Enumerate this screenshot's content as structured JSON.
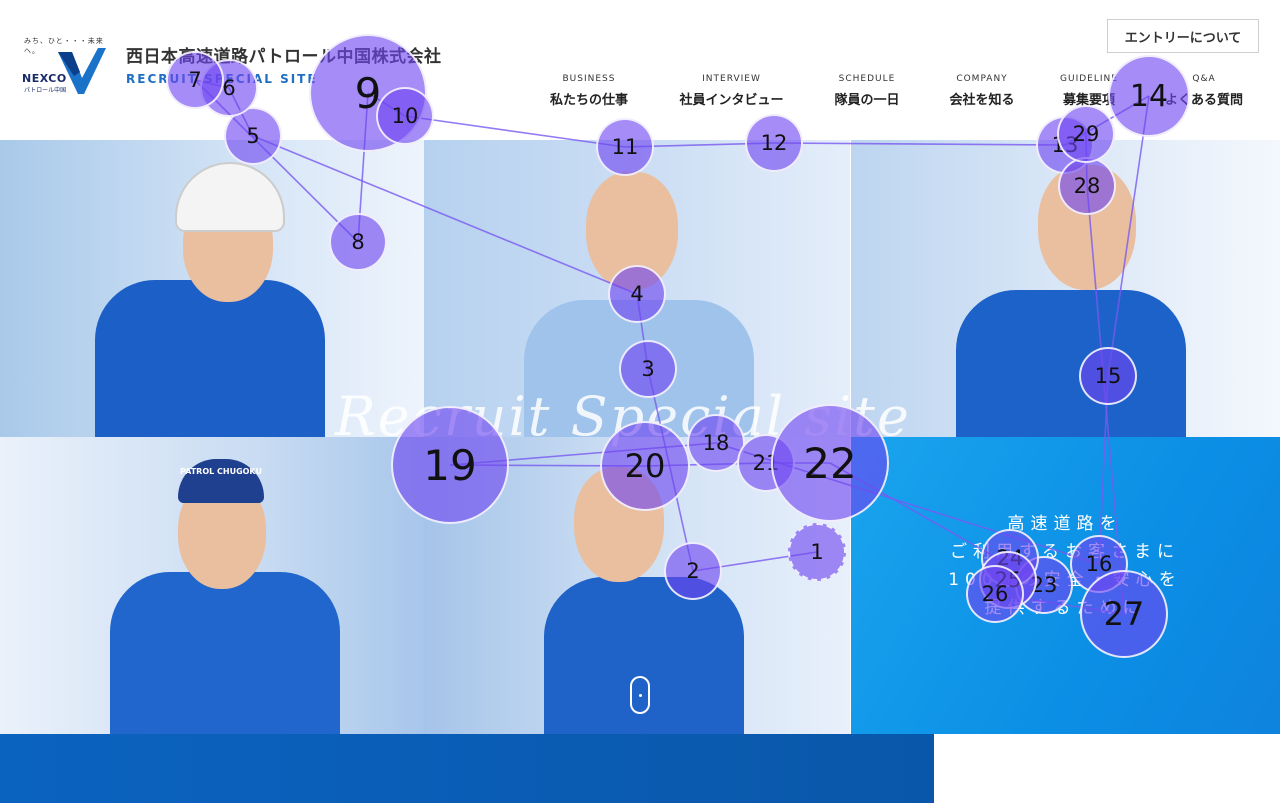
{
  "header": {
    "logo": {
      "tagline": "みち、ひと・・・未来へ。",
      "brand": "NEXCO",
      "sub": "パトロール中国"
    },
    "title": "西日本高速道路パトロール中国株式会社",
    "subtitle": "RECRUIT SPECIAL SITE",
    "entry_label": "エントリーについて",
    "nav": [
      {
        "en": "BUSINESS",
        "jp": "私たちの仕事"
      },
      {
        "en": "INTERVIEW",
        "jp": "社員インタビュー"
      },
      {
        "en": "SCHEDULE",
        "jp": "隊員の一日"
      },
      {
        "en": "COMPANY",
        "jp": "会社を知る"
      },
      {
        "en": "GUIDELINE",
        "jp": "募集要項"
      },
      {
        "en": "Q&A",
        "jp": "よくある質問"
      }
    ]
  },
  "hero": {
    "script_text": "Recruit Special site",
    "catch_lines": [
      "高速道路を",
      "ご利用するお客さまに",
      "100%の安全・安心を",
      "提供するために"
    ],
    "cap_text": "PATROL CHUGOKU"
  },
  "colors": {
    "brand_blue": "#1e6fc4",
    "band_blue": "#0b63c0",
    "accent_cyan": "#0b8fe5",
    "fixation": "#6e46f0"
  },
  "fixations": [
    {
      "n": "1"
    },
    {
      "n": "2"
    },
    {
      "n": "3"
    },
    {
      "n": "4"
    },
    {
      "n": "5"
    },
    {
      "n": "6"
    },
    {
      "n": "7"
    },
    {
      "n": "8"
    },
    {
      "n": "9"
    },
    {
      "n": "10"
    },
    {
      "n": "11"
    },
    {
      "n": "12"
    },
    {
      "n": "13"
    },
    {
      "n": "14"
    },
    {
      "n": "15"
    },
    {
      "n": "16"
    },
    {
      "n": "18"
    },
    {
      "n": "19"
    },
    {
      "n": "20"
    },
    {
      "n": "21"
    },
    {
      "n": "22"
    },
    {
      "n": "23"
    },
    {
      "n": "24"
    },
    {
      "n": "25"
    },
    {
      "n": "26"
    },
    {
      "n": "27"
    },
    {
      "n": "28"
    },
    {
      "n": "29"
    }
  ]
}
